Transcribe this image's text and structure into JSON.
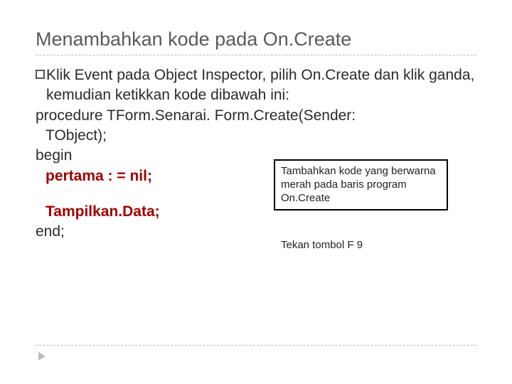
{
  "title": "Menambahkan kode pada On.Create",
  "intro": {
    "prefix": "Klik",
    "rest": " Event pada Object Inspector, pilih On.Create dan klik ganda, kemudian ketikkan kode dibawah ini:"
  },
  "code": {
    "proc1": "procedure TForm.Senarai. Form.Create(Sender:",
    "proc2": "TObject);",
    "begin": "begin",
    "line1": "pertama : = nil;",
    "line2": "Tampilkan.Data;",
    "end": "end;"
  },
  "callout": "Tambahkan kode yang berwarna merah pada baris program  On.Create",
  "f9note": "Tekan tombol F 9"
}
